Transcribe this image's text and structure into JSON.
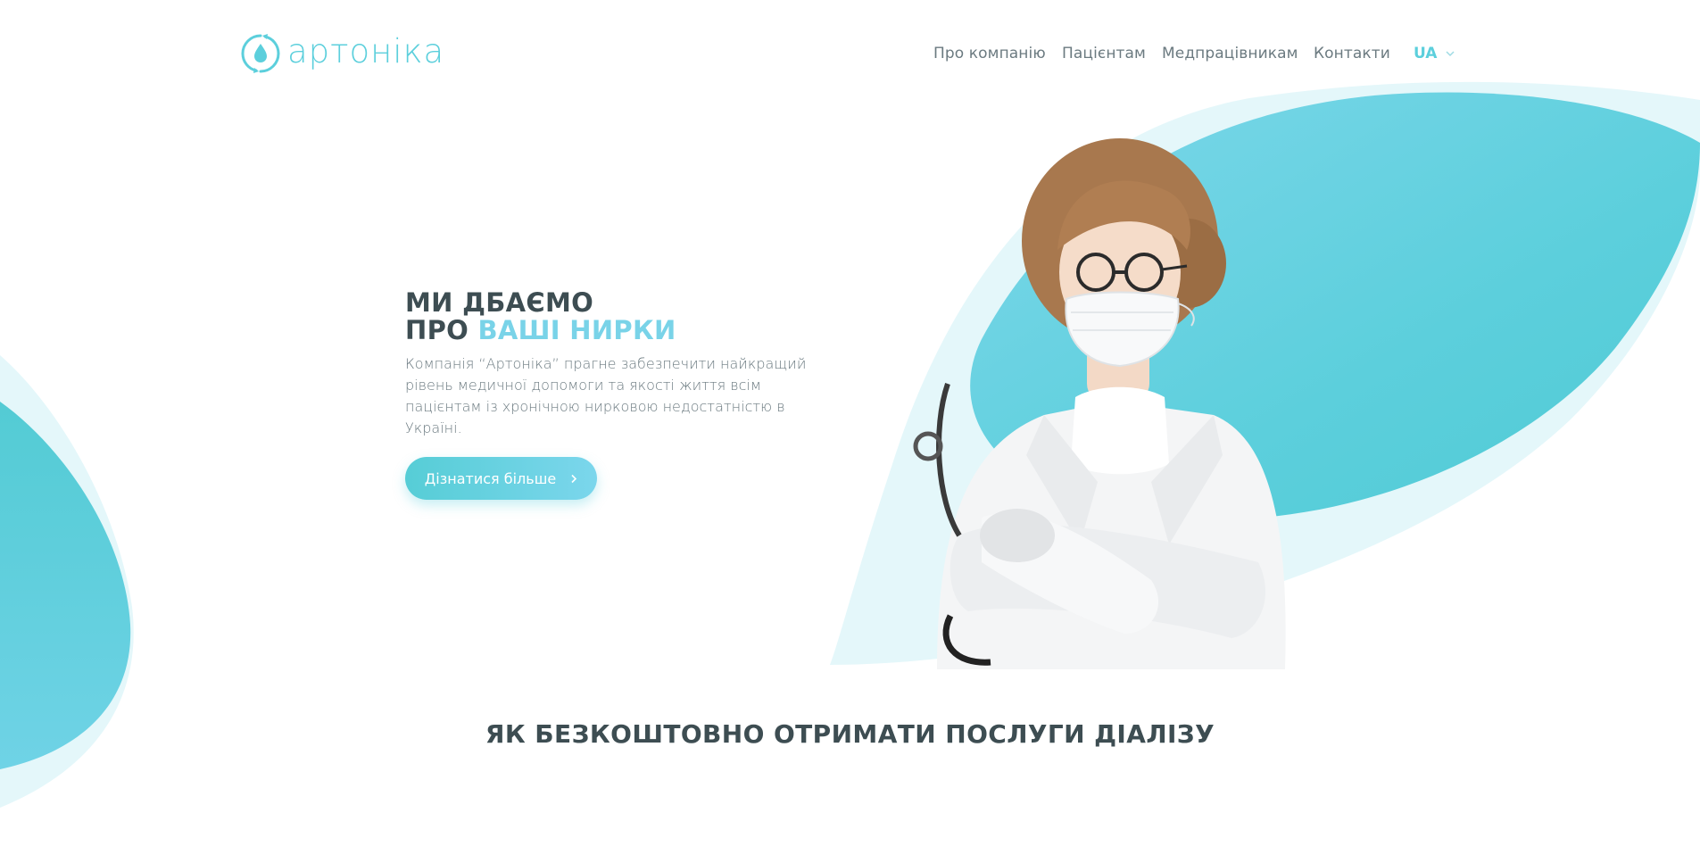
{
  "brand": {
    "name": "артоніка",
    "color": "#5ccfdc"
  },
  "nav": {
    "items": [
      {
        "label": "Про компанію"
      },
      {
        "label": "Пацієнтам"
      },
      {
        "label": "Медпрацівникам"
      },
      {
        "label": "Контакти"
      }
    ],
    "language": "UA"
  },
  "hero": {
    "title_line1": "МИ ДБАЄМО",
    "title_line2_prefix": "ПРО ",
    "title_line2_accent": "ВАШІ НИРКИ",
    "description": "Компанія “Артоніка” прагне забезпечити найкращий рівень медичної допомоги та якості життя всім пацієнтам із хронічною нирковою недостатністю в Україні.",
    "cta_label": "Дізнатися більше"
  },
  "section": {
    "title": "ЯК БЕЗКОШТОВНО ОТРИМАТИ ПОСЛУГИ ДІАЛІЗУ"
  },
  "colors": {
    "accent": "#5ccfdc",
    "accent_light": "#79d3e8",
    "heading": "#3d4d52",
    "text": "#6b7a80"
  }
}
